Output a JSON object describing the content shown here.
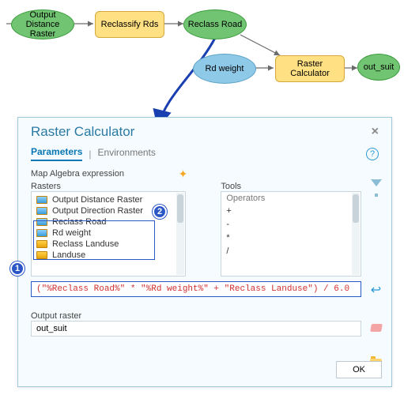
{
  "flowchart": {
    "nodes": {
      "output_distance": "Output Distance Raster",
      "reclassify_rds": "Reclassify Rds",
      "reclass_road": "Reclass Road",
      "rd_weight": "Rd weight",
      "raster_calculator": "Raster Calculator",
      "out_suit": "out_suit"
    }
  },
  "dialog": {
    "title": "Raster Calculator",
    "tabs": {
      "parameters": "Parameters",
      "environments": "Environments"
    },
    "section_label": "Map Algebra expression",
    "rasters_label": "Rasters",
    "tools_label": "Tools",
    "raster_items": [
      "Output Distance Raster",
      "Output Direction Raster",
      "Reclass Road",
      "Rd weight",
      "Reclass Landuse",
      "Landuse"
    ],
    "operators_header": "Operators",
    "operators": [
      "+",
      "-",
      "*",
      "/"
    ],
    "expression_display": "(\"%Reclass Road%\"  *  \"%Rd weight%\" + \"Reclass Landuse\") / 6.0",
    "output_label": "Output raster",
    "output_value": "out_suit",
    "ok": "OK",
    "callouts": {
      "one": "1",
      "two": "2"
    },
    "help": "?"
  }
}
